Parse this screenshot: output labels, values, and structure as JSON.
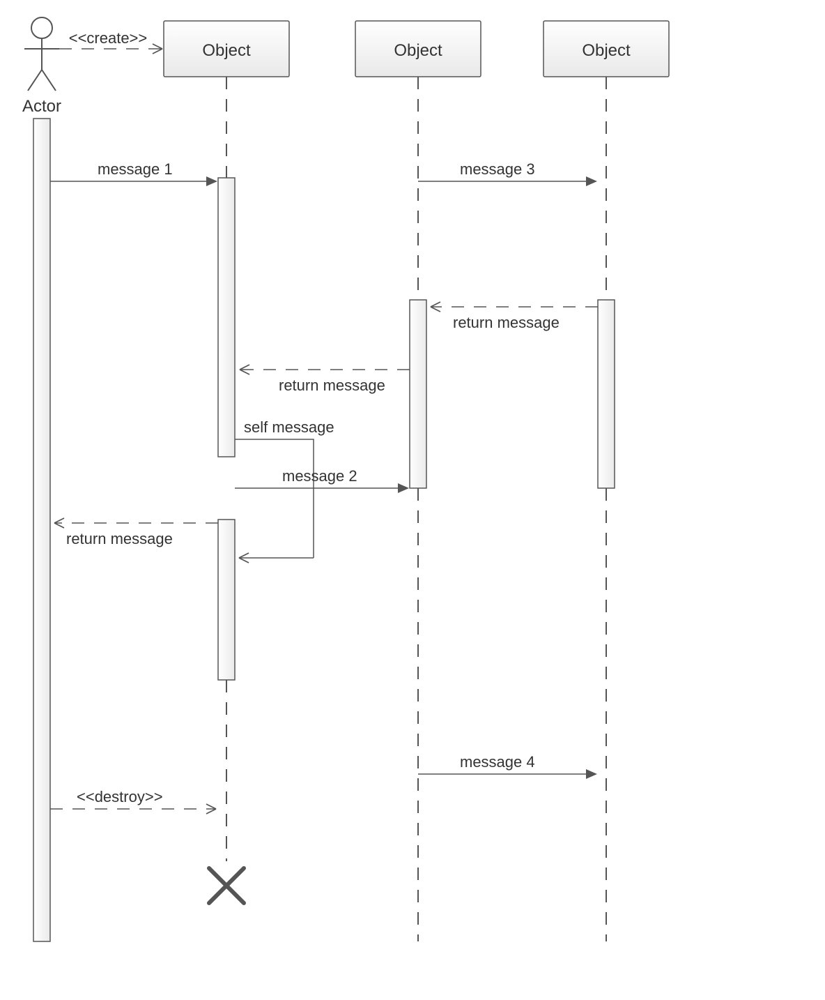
{
  "lifelines": {
    "actor_label": "Actor",
    "object1_label": "Object",
    "object2_label": "Object",
    "object3_label": "Object"
  },
  "messages": {
    "create": "<<create>>",
    "msg1": "message 1",
    "msg2": "message 2",
    "msg3": "message 3",
    "msg4": "message 4",
    "return_32": "return message",
    "return_21": "return message",
    "return_1actor": "return message",
    "self_msg": "self message",
    "destroy": "<<destroy>>"
  }
}
